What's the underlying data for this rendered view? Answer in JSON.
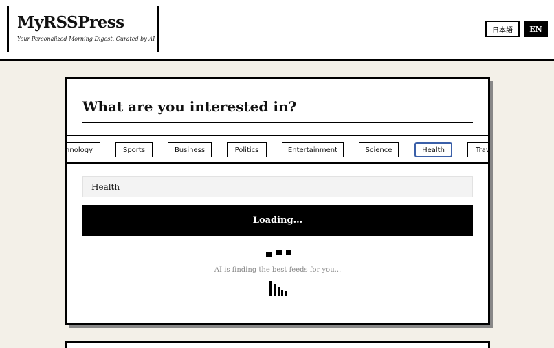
{
  "app": {
    "title": "MyRSSPress",
    "subtitle": "Your Personalized Morning Digest, Curated by AI"
  },
  "language": {
    "ja_label": "日本語",
    "en_label": "EN",
    "selected": "EN"
  },
  "interest": {
    "heading": "What are you interested in?",
    "chips": [
      "Technology",
      "Sports",
      "Business",
      "Politics",
      "Entertainment",
      "Science",
      "Health",
      "Travel"
    ],
    "selected_chip": "Health",
    "input_value": "Health",
    "button_label": "Loading...",
    "status_text": "AI is finding the best feeds for you..."
  },
  "colors": {
    "accent": "#000000",
    "selected_chip_border": "#3a5fa8",
    "background": "#f3f0e8"
  }
}
